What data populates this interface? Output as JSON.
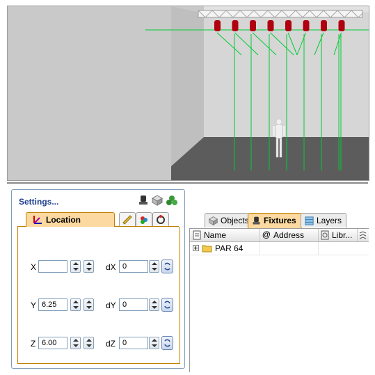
{
  "viewport": {
    "fixture_count": 8,
    "colors": {
      "room": "#c9c9c9",
      "floor": "#5c5c5c",
      "beam": "#00cc33",
      "fixture": "#b00010",
      "truss": "#f4f4f4"
    }
  },
  "settings_panel": {
    "title": "Settings...",
    "header_icons": [
      "fixture-head-icon",
      "cube-icon",
      "group-spheres-icon"
    ],
    "tabs": [
      {
        "label": "Location",
        "icon": "axes-icon",
        "active": true
      },
      {
        "label": "",
        "icon": "ruler-icon",
        "active": false
      },
      {
        "label": "",
        "icon": "color-palette-icon",
        "active": false
      },
      {
        "label": "",
        "icon": "rotation-icon",
        "active": false
      }
    ],
    "location": {
      "x_label": "X",
      "x_value": "",
      "y_label": "Y",
      "y_value": "6.25",
      "z_label": "Z",
      "z_value": "6.00",
      "dx_label": "dX",
      "dx_value": "0",
      "dy_label": "dY",
      "dy_value": "0",
      "dz_label": "dZ",
      "dz_value": "0"
    }
  },
  "browser_panel": {
    "tabs": [
      {
        "label": "Objects",
        "icon": "cube-icon",
        "active": false
      },
      {
        "label": "Fixtures",
        "icon": "fixture-head-icon",
        "active": true
      },
      {
        "label": "Layers",
        "icon": "layers-icon",
        "active": false
      }
    ],
    "columns": [
      {
        "label": "Name",
        "icon": "name-column-icon"
      },
      {
        "label": "Address",
        "icon": "at-icon"
      },
      {
        "label": "Libr...",
        "icon": "library-icon"
      }
    ],
    "rows": [
      {
        "name": "PAR 64",
        "expanded": false,
        "icon": "folder-icon"
      }
    ]
  }
}
